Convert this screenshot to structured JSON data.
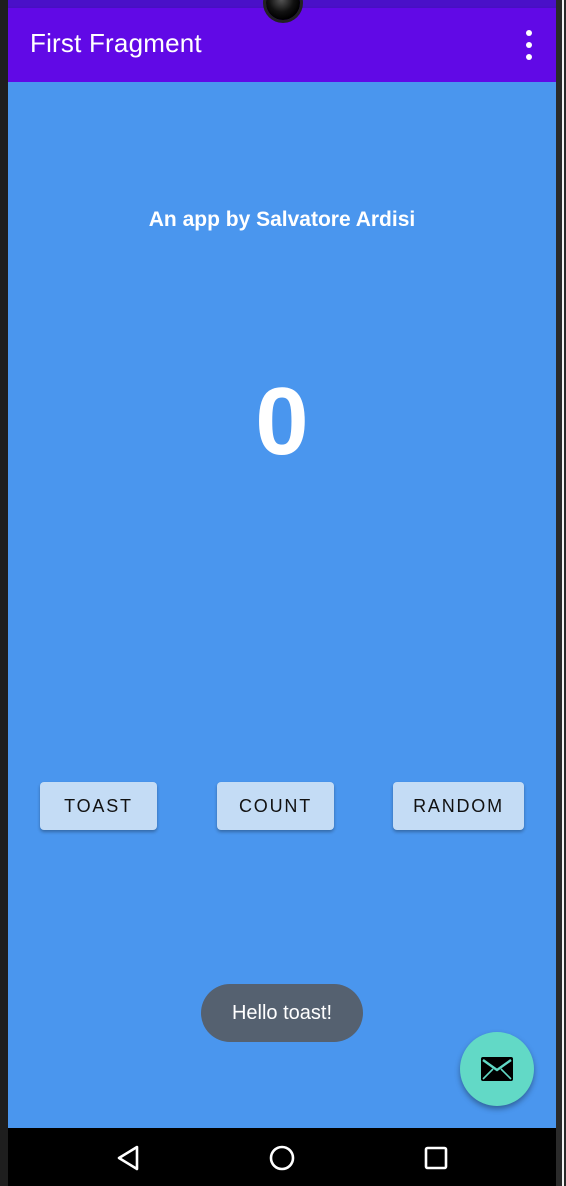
{
  "app_bar": {
    "title": "First Fragment",
    "menu_icon": "more-vert-icon",
    "color": "#6109e6"
  },
  "main": {
    "byline": "An app by Salvatore Ardisi",
    "counter": "0",
    "background_color": "#4a96ee"
  },
  "buttons": {
    "toast": "TOAST",
    "count": "COUNT",
    "random": "RANDOM",
    "color": "#c4dcf5"
  },
  "toast_message": {
    "text": "Hello toast!",
    "color": "#556170"
  },
  "fab": {
    "icon": "email-icon",
    "color": "#62d9c6"
  },
  "nav_bar": {
    "back_icon": "back-triangle-icon",
    "home_icon": "home-circle-icon",
    "recents_icon": "recents-square-icon"
  }
}
